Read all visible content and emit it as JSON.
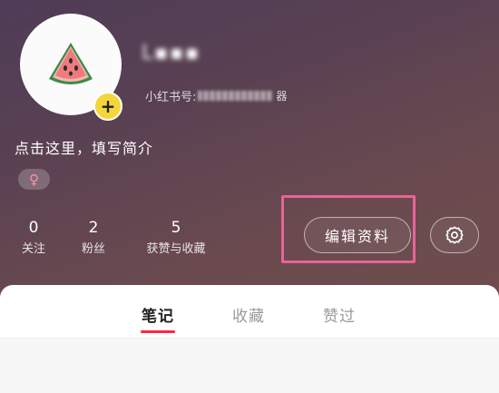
{
  "profile": {
    "username": "L▪▪▪",
    "id_label": "小红书号:",
    "id_suffix": "器",
    "bio_placeholder": "点击这里，填写简介",
    "gender_symbol": "♀",
    "avatar_icon": "watermelon-icon",
    "add_symbol": "+"
  },
  "stats": [
    {
      "value": "0",
      "label": "关注"
    },
    {
      "value": "2",
      "label": "粉丝"
    },
    {
      "value": "5",
      "label": "获赞与收藏"
    }
  ],
  "actions": {
    "edit_label": "编辑资料",
    "settings_icon": "gear-icon"
  },
  "tabs": [
    {
      "label": "笔记",
      "active": true
    },
    {
      "label": "收藏",
      "active": false
    },
    {
      "label": "赞过",
      "active": false
    }
  ],
  "colors": {
    "accent": "#ff2442",
    "highlight": "#e6649a",
    "badge": "#f5d63a",
    "header_start": "#4e3c56",
    "header_end": "#6f4d4d"
  }
}
